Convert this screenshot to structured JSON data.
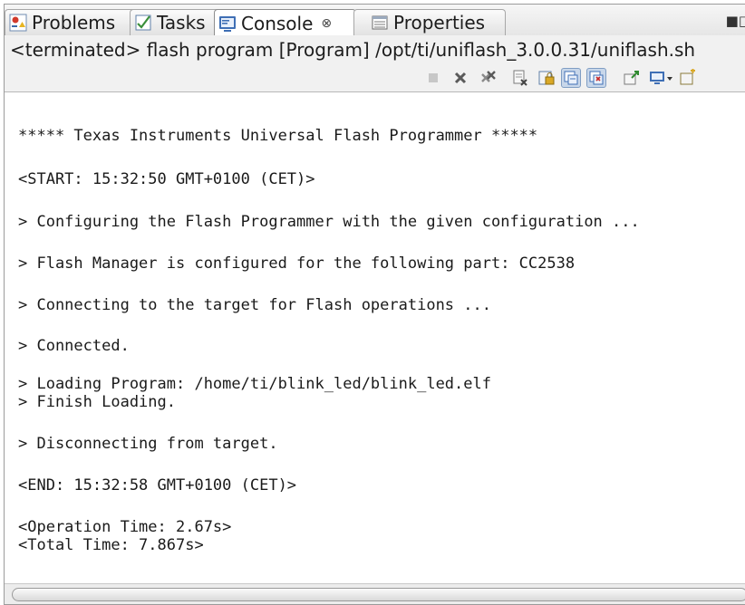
{
  "tabs": [
    {
      "label": "Problems",
      "icon": "problems-icon"
    },
    {
      "label": "Tasks",
      "icon": "tasks-icon"
    },
    {
      "label": "Console",
      "icon": "console-icon",
      "close": "⊗"
    },
    {
      "label": "Properties",
      "icon": "properties-icon"
    }
  ],
  "header": {
    "status": "<terminated> flash program [Program] /opt/ti/uniflash_3.0.0.31/uniflash.sh"
  },
  "toolbar": {
    "icons": [
      "terminate-icon",
      "remove-launch-icon",
      "remove-all-terminated-icon",
      "clear-console-icon",
      "scroll-lock-icon",
      "show-on-stdout-icon",
      "show-on-stderr-icon",
      "pin-console-icon",
      "display-console-icon",
      "open-console-icon"
    ]
  },
  "console": {
    "lines": [
      "***** Texas Instruments Universal Flash Programmer *****",
      "<START: 15:32:50 GMT+0100 (CET)>",
      "> Configuring the Flash Programmer with the given configuration ...",
      "> Flash Manager is configured for the following part: CC2538",
      "> Connecting to the target for Flash operations ...",
      "> Connected.",
      "> Loading Program: /home/ti/blink_led/blink_led.elf",
      "> Finish Loading.",
      "> Disconnecting from target.",
      "<END: 15:32:58 GMT+0100 (CET)>",
      "<Operation Time: 2.67s>",
      "<Total Time: 7.867s>"
    ]
  },
  "colors": {
    "accent": "#3f6fb5",
    "pressed_bg": "#c8d7ea"
  }
}
